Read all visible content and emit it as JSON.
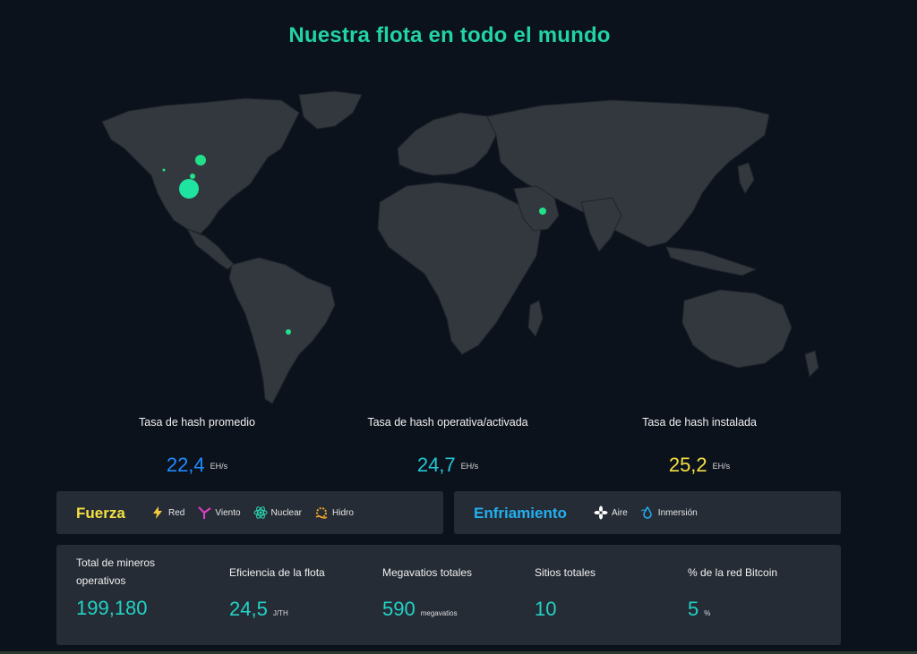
{
  "title": "Nuestra flota en todo el mundo",
  "colors": {
    "accent_green": "#22d3a6",
    "blue": "#1e8cff",
    "cyan": "#22c7d6",
    "yellow": "#f5e042"
  },
  "map": {
    "markers": [
      {
        "name": "marker-north-america-1",
        "icon": "circle"
      },
      {
        "name": "marker-north-america-2",
        "icon": "circle"
      },
      {
        "name": "marker-north-america-3",
        "icon": "circle"
      },
      {
        "name": "marker-north-america-4",
        "icon": "circle"
      },
      {
        "name": "marker-south-america",
        "icon": "circle"
      },
      {
        "name": "marker-middle-east",
        "icon": "circle"
      }
    ]
  },
  "hashrates": [
    {
      "label": "Tasa de hash promedio",
      "value": "22,4",
      "unit": "EH/s"
    },
    {
      "label": "Tasa de hash operativa/activada",
      "value": "24,7",
      "unit": "EH/s"
    },
    {
      "label": "Tasa de hash instalada",
      "value": "25,2",
      "unit": "EH/s"
    }
  ],
  "power": {
    "title": "Fuerza",
    "items": [
      {
        "label": "Red",
        "icon": "lightning-icon"
      },
      {
        "label": "Viento",
        "icon": "wind-turbine-icon"
      },
      {
        "label": "Nuclear",
        "icon": "atom-icon"
      },
      {
        "label": "Hidro",
        "icon": "hydro-icon"
      }
    ]
  },
  "cooling": {
    "title": "Enfriamiento",
    "items": [
      {
        "label": "Aire",
        "icon": "fan-icon"
      },
      {
        "label": "Inmersión",
        "icon": "droplet-icon"
      }
    ]
  },
  "metrics": [
    {
      "label": "Total de mineros operativos",
      "value": "199,180",
      "unit": ""
    },
    {
      "label": "Eficiencia de la flota",
      "value": "24,5",
      "unit": "J/TH"
    },
    {
      "label": "Megavatios totales",
      "value": "590",
      "unit": "megavatios"
    },
    {
      "label": "Sitios totales",
      "value": "10",
      "unit": ""
    },
    {
      "label": "% de la red Bitcoin",
      "value": "5",
      "unit": "%"
    }
  ]
}
